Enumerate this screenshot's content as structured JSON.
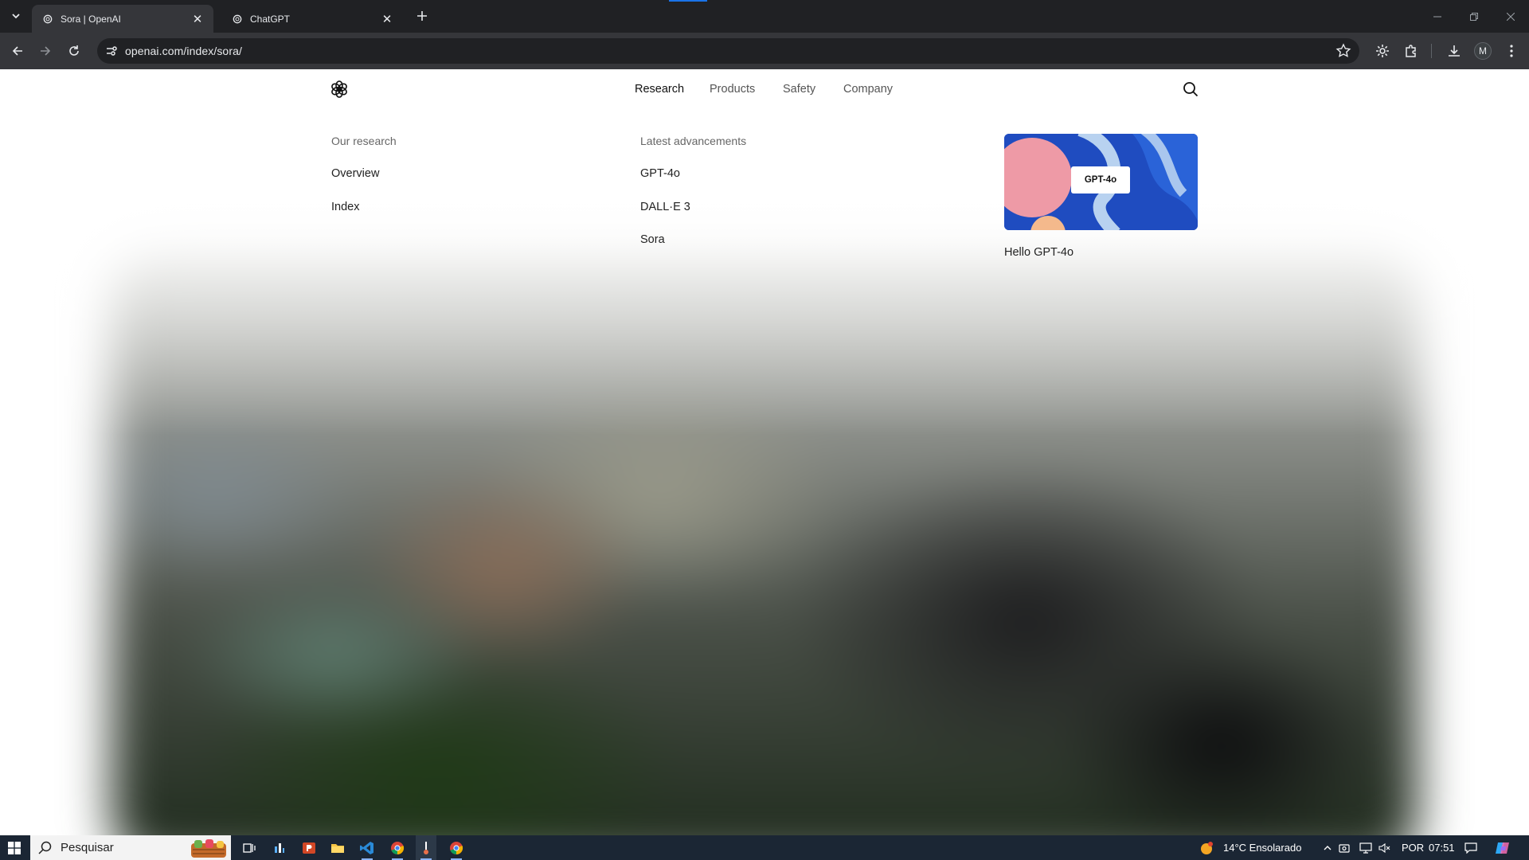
{
  "browser": {
    "tabs": [
      {
        "title": "Sora | OpenAI",
        "active": true
      },
      {
        "title": "ChatGPT",
        "active": false
      }
    ],
    "url": "openai.com/index/sora/",
    "profile_initial": "M"
  },
  "site": {
    "nav": [
      "Research",
      "Products",
      "Safety",
      "Company"
    ],
    "menu": {
      "col1_heading": "Our research",
      "col1_links": [
        "Overview",
        "Index"
      ],
      "col2_heading": "Latest advancements",
      "col2_links": [
        "GPT-4o",
        "DALL·E 3",
        "Sora"
      ],
      "promo_badge": "GPT-4o",
      "promo_caption": "Hello GPT-4o"
    }
  },
  "taskbar": {
    "search_placeholder": "Pesquisar",
    "weather": "14°C  Ensolarado",
    "lang": "POR",
    "time": "07:51"
  },
  "colors": {
    "chrome_dark": "#202124",
    "toolbar": "#35363a",
    "taskbar": "#1b2634",
    "promo_blue": "#1f4cc0"
  }
}
